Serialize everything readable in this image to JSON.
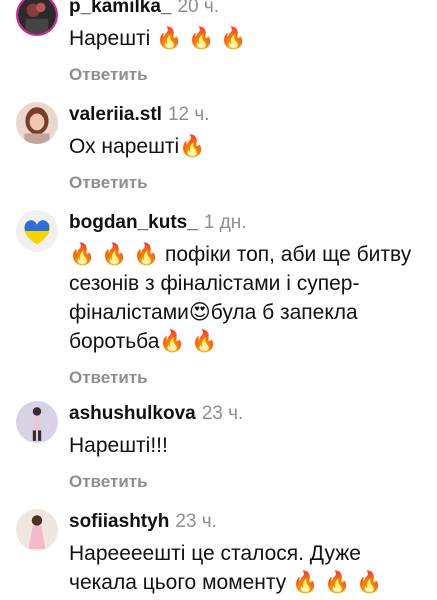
{
  "reply_label": "Ответить",
  "comments": [
    {
      "username": "p_kamilka_",
      "time": "20 ч.",
      "text": "Нарешті 🔥 🔥 🔥"
    },
    {
      "username": "valeriia.stl",
      "time": "12 ч.",
      "text": "Ох нарешті🔥"
    },
    {
      "username": "bogdan_kuts_",
      "time": "1 дн.",
      "text": "🔥 🔥 🔥 пофіки топ, аби ще битву сезонів з фіналістами і супер-фіналістами😍була б запекла боротьба🔥 🔥"
    },
    {
      "username": "ashushulkova",
      "time": "23 ч.",
      "text": "Нарешті!!!"
    },
    {
      "username": "sofiiashtyh",
      "time": "23 ч.",
      "text": "Нареееешті це сталося. Дуже чекала цього моменту 🔥 🔥 🔥"
    }
  ],
  "colors": {
    "meta_gray": "#8e8e8e",
    "story_ring": "#d6249f",
    "text": "#111111"
  }
}
